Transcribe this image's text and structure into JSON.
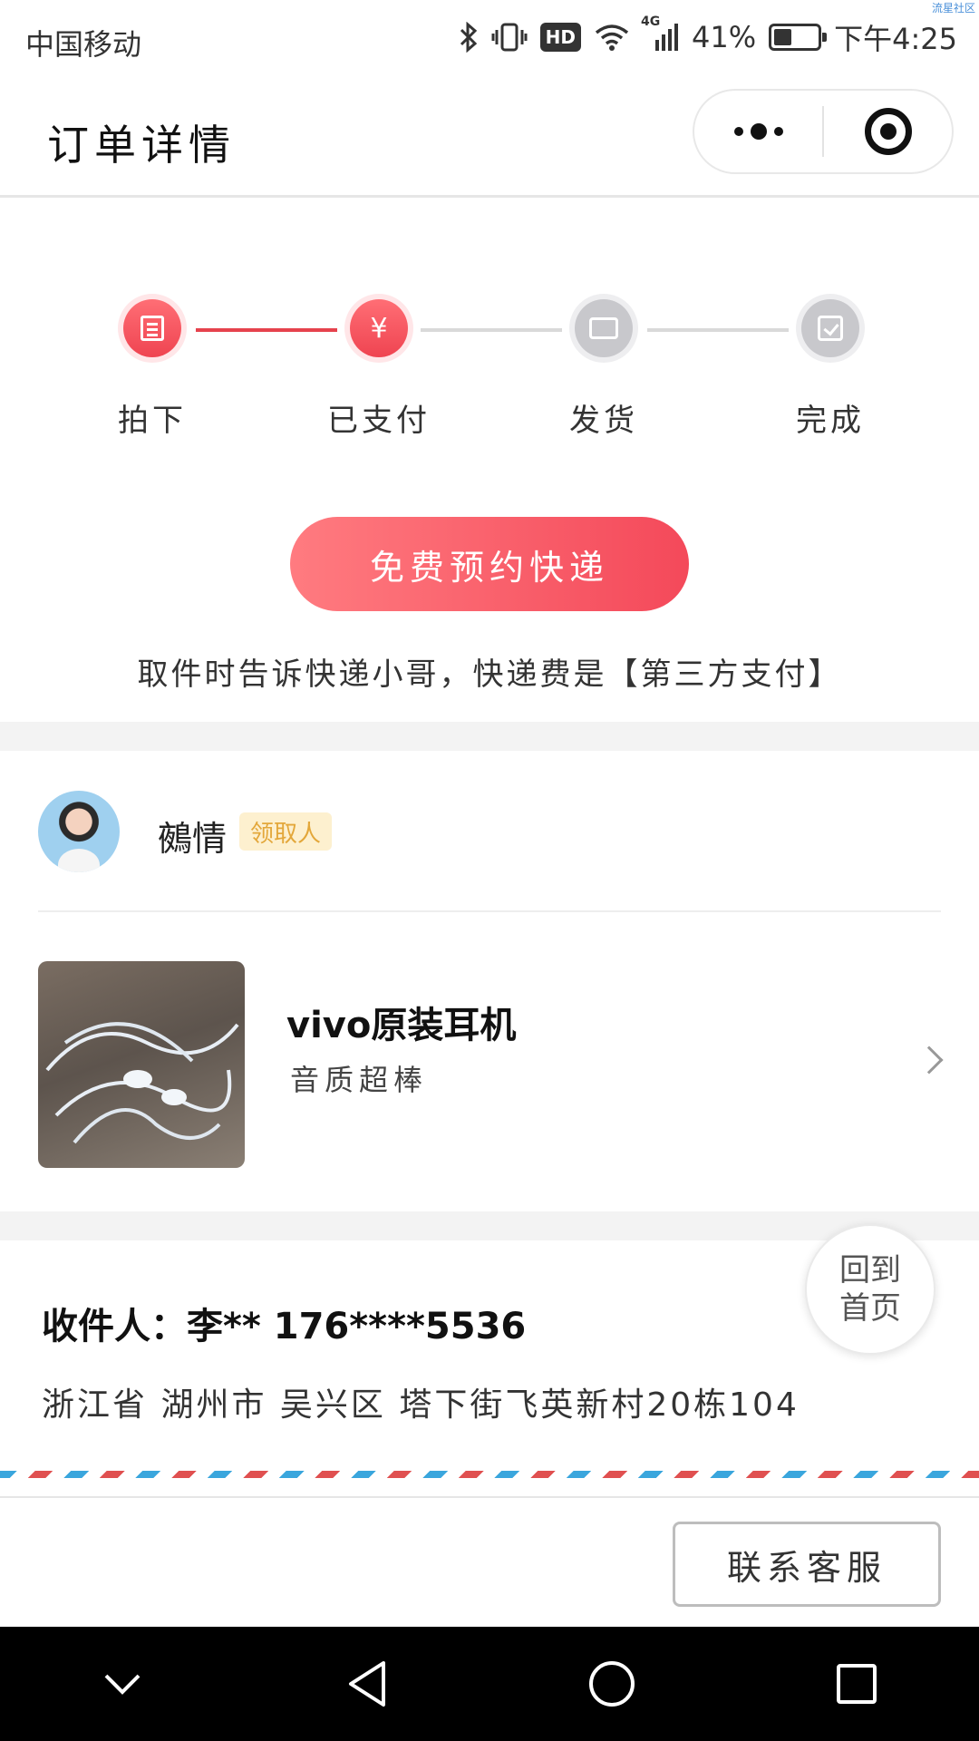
{
  "status_bar": {
    "carrier": "中国移动",
    "hd": "HD",
    "network": "4G",
    "battery_percent": "41%",
    "battery_level": 0.41,
    "time": "下午4:25",
    "corner_mark": "流星社区"
  },
  "header": {
    "title": "订单详情"
  },
  "steps": {
    "items": [
      {
        "label": "拍下",
        "icon": "list-icon",
        "active": true
      },
      {
        "label": "已支付",
        "icon": "yen-icon",
        "active": true
      },
      {
        "label": "发货",
        "icon": "truck-icon",
        "active": false
      },
      {
        "label": "完成",
        "icon": "check-icon",
        "active": false
      }
    ],
    "yen_symbol": "¥"
  },
  "cta": {
    "label": "免费预约快递"
  },
  "notice": {
    "text": "取件时告诉快递小哥，快递费是【第三方支付】"
  },
  "receiver_user": {
    "name": "鵺情",
    "tag": "领取人"
  },
  "product": {
    "title": "vivo原装耳机",
    "subtitle": "音质超棒"
  },
  "address": {
    "line1": "收件人：李** 176****5536",
    "line2": "浙江省 湖州市 吴兴区 塔下街飞英新村20栋104"
  },
  "home_button": {
    "label": "回到首页"
  },
  "contact_button": {
    "label": "联系客服"
  },
  "colors": {
    "accent": "#ef4451",
    "inactive": "#c8c8cc",
    "tag_bg": "#fdf0cf",
    "tag_text": "#e3a73a"
  }
}
